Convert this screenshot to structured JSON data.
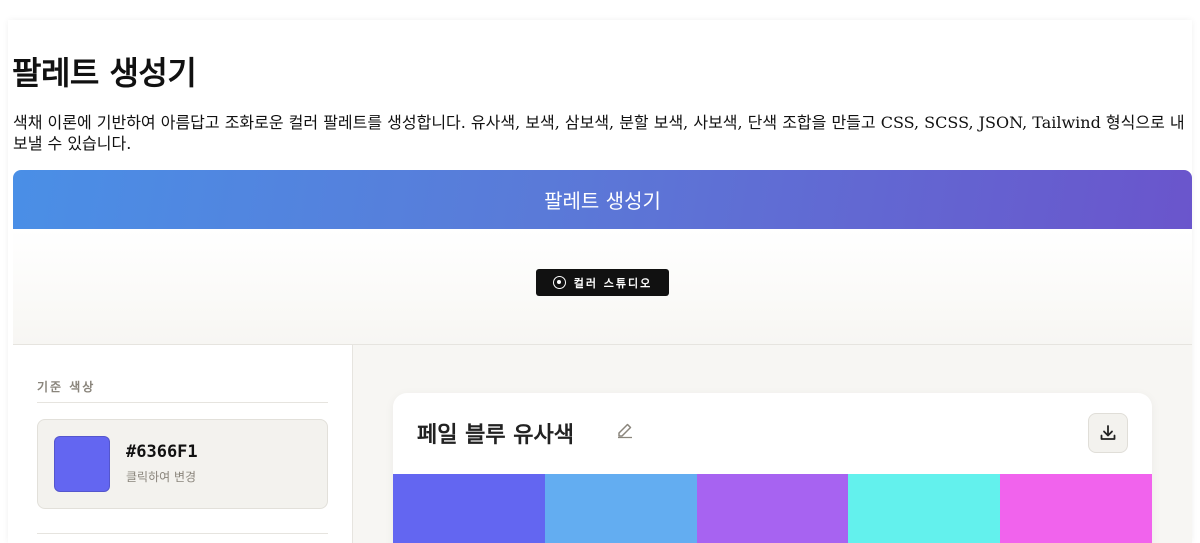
{
  "page": {
    "title": "팔레트 생성기",
    "description": "색채 이론에 기반하여 아름답고 조화로운 컬러 팔레트를 생성합니다. 유사색, 보색, 삼보색, 분할 보색, 사보색, 단색 조합을 만들고 CSS, SCSS, JSON, Tailwind 형식으로 내보낼 수 있습니다."
  },
  "banner": {
    "title": "팔레트 생성기"
  },
  "studio": {
    "badge_label": "컬러 스튜디오",
    "icon": "target-icon"
  },
  "sidebar": {
    "heading": "기준 색상",
    "base_color": {
      "hex": "#6366F1",
      "hint": "클릭하여 변경"
    }
  },
  "palette": {
    "name": "페일 블루 유사색",
    "edit_icon": "edit-icon",
    "download_icon": "download-icon",
    "swatches": [
      "#6366F1",
      "#63ADF1",
      "#A763F1",
      "#63F1ED",
      "#F163ED"
    ]
  },
  "colors": {
    "banner_start": "#4A8FE6",
    "banner_end": "#6A55CC",
    "badge_bg": "#111111"
  }
}
